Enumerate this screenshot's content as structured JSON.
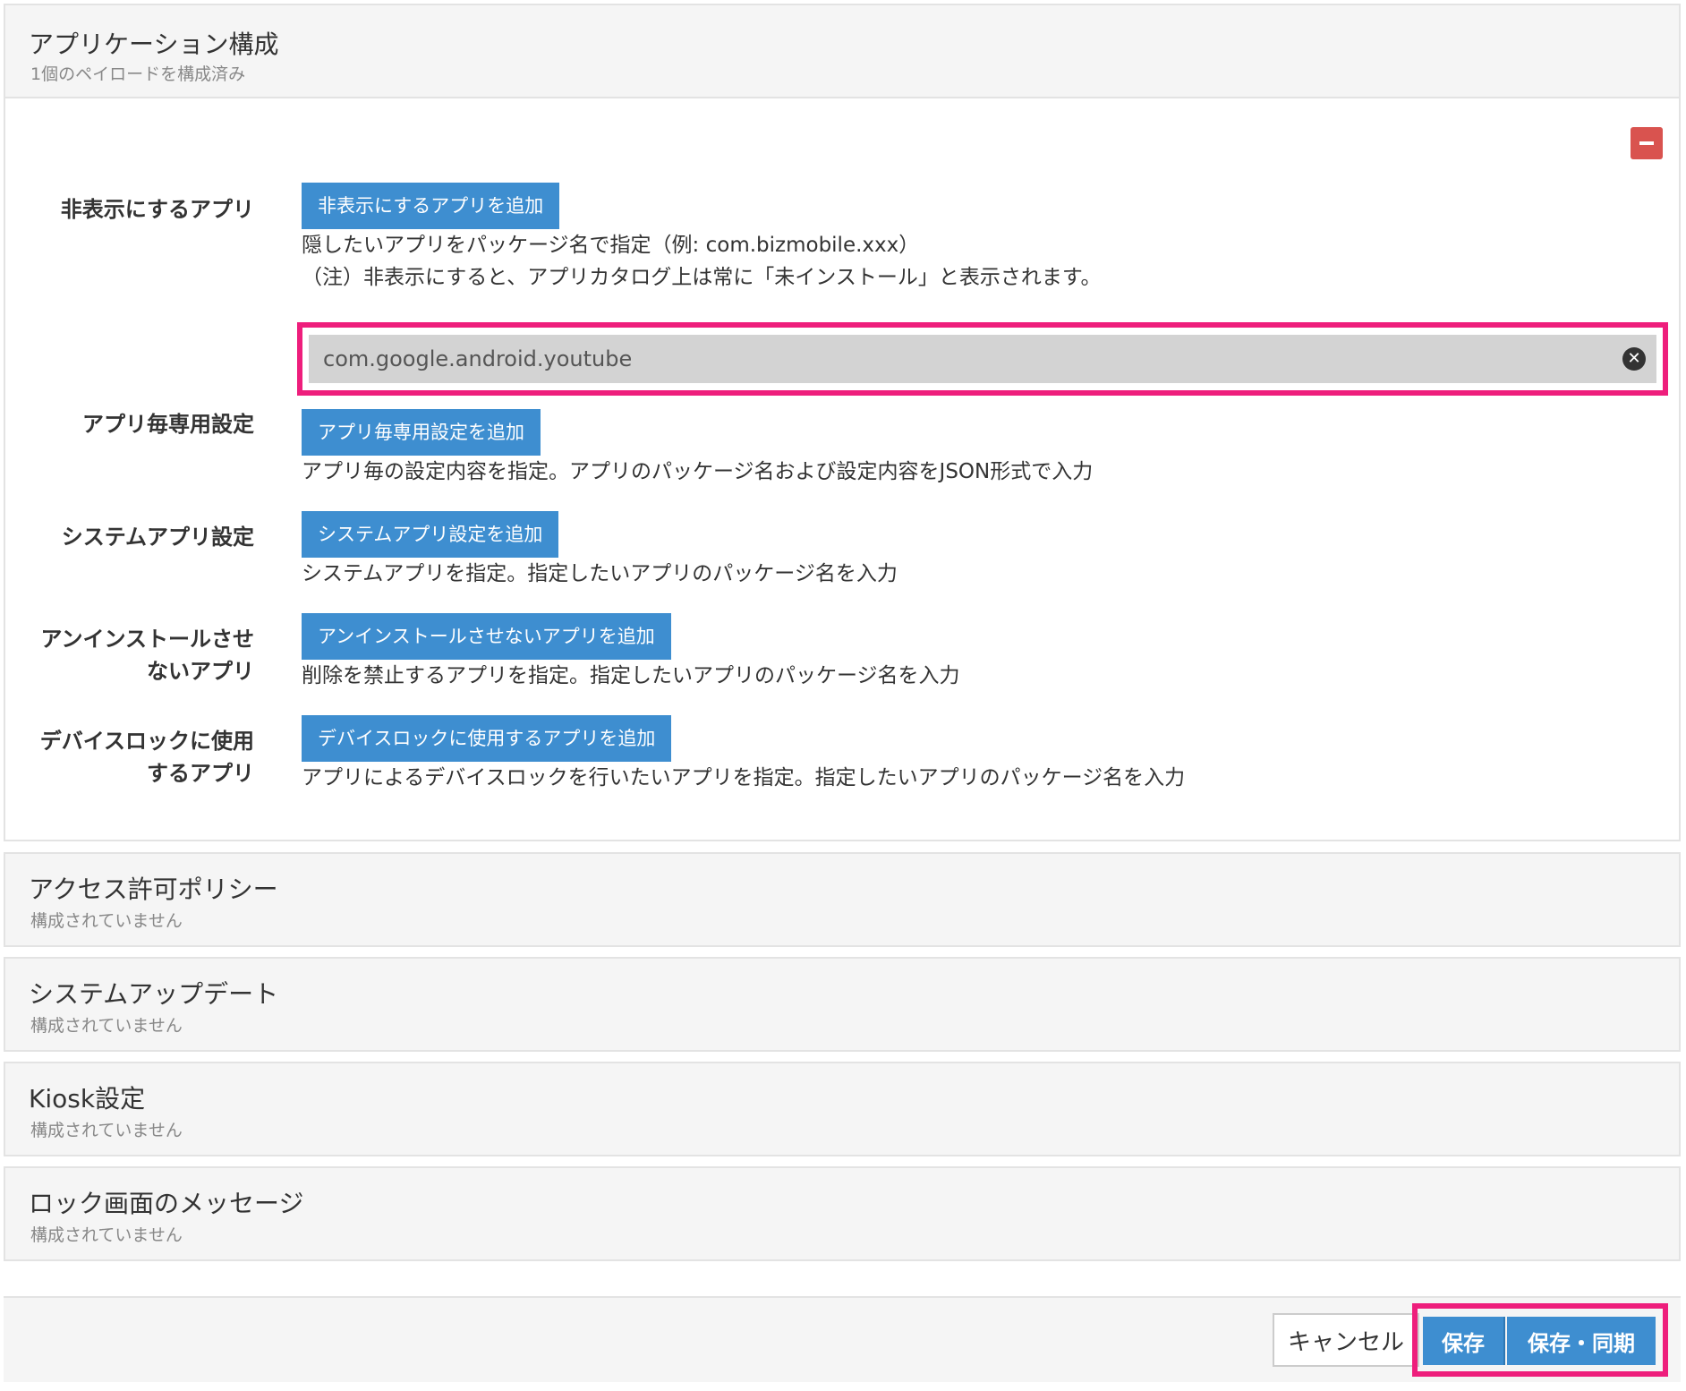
{
  "app_config": {
    "title": "アプリケーション構成",
    "subtitle": "1個のペイロードを構成済み"
  },
  "hidden_apps": {
    "label": "非表示にするアプリ",
    "add_button": "非表示にするアプリを追加",
    "help_line1": "隠したいアプリをパッケージ名で指定（例: com.bizmobile.xxx）",
    "help_line2": "（注）非表示にすると、アプリカタログ上は常に「未インストール」と表示されます。",
    "package_value": "com.google.android.youtube"
  },
  "per_app_settings": {
    "label": "アプリ毎専用設定",
    "add_button": "アプリ毎専用設定を追加",
    "help": "アプリ毎の設定内容を指定。アプリのパッケージ名および設定内容をJSON形式で入力"
  },
  "system_apps": {
    "label": "システムアプリ設定",
    "add_button": "システムアプリ設定を追加",
    "help": "システムアプリを指定。指定したいアプリのパッケージ名を入力"
  },
  "uninstall_block": {
    "label_line1": "アンインストールさせ",
    "label_line2": "ないアプリ",
    "add_button": "アンインストールさせないアプリを追加",
    "help": "削除を禁止するアプリを指定。指定したいアプリのパッケージ名を入力"
  },
  "device_lock": {
    "label_line1": "デバイスロックに使用",
    "label_line2": "するアプリ",
    "add_button": "デバイスロックに使用するアプリを追加",
    "help": "アプリによるデバイスロックを行いたいアプリを指定。指定したいアプリのパッケージ名を入力"
  },
  "sections": [
    {
      "title": "アクセス許可ポリシー",
      "subtitle": "構成されていません"
    },
    {
      "title": "システムアップデート",
      "subtitle": "構成されていません"
    },
    {
      "title": "Kiosk設定",
      "subtitle": "構成されていません"
    },
    {
      "title": "ロック画面のメッセージ",
      "subtitle": "構成されていません"
    }
  ],
  "footer": {
    "cancel": "キャンセル",
    "save": "保存",
    "save_sync": "保存・同期"
  },
  "colors": {
    "primary_button": "#3e8ed0",
    "danger_button": "#d9534f",
    "highlight": "#ee1e7c"
  },
  "icons": {
    "remove": "minus-icon",
    "clear": "clear-circle-icon"
  }
}
